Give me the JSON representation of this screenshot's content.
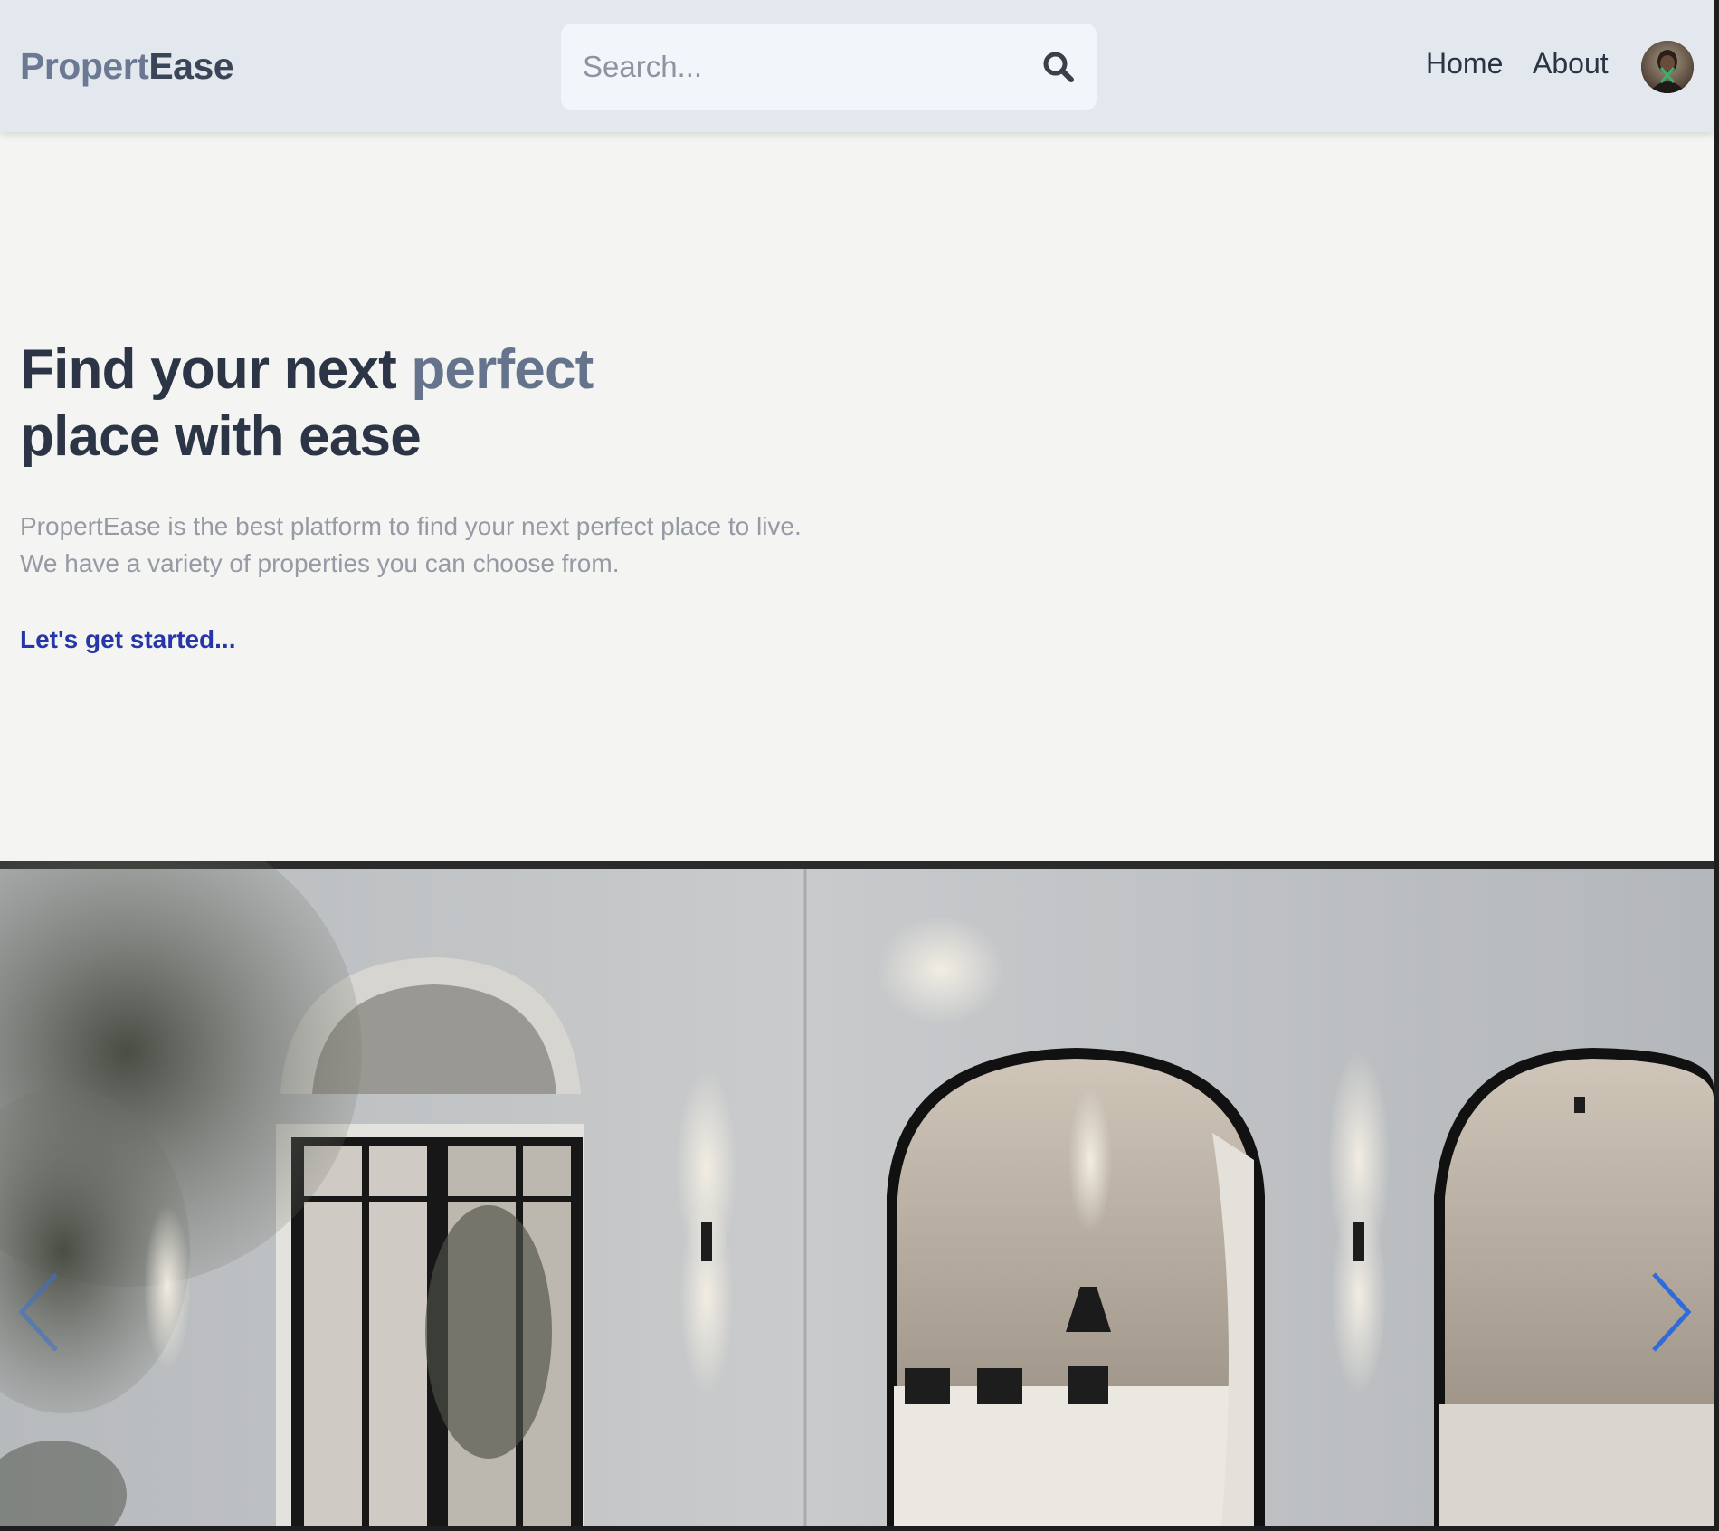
{
  "brand": {
    "part1": "Propert",
    "part2": "Ease"
  },
  "search": {
    "placeholder": "Search...",
    "value": "",
    "icon": "search-icon"
  },
  "nav": {
    "home_label": "Home",
    "about_label": "About",
    "avatar_icon": "user-avatar"
  },
  "hero": {
    "title_before": "Find your next ",
    "title_accent": "perfect",
    "title_after": "place with ease",
    "description_line1": "PropertEase is the best platform to find your next perfect place to live.",
    "description_line2": "We have a variety of properties you can choose from.",
    "cta_label": "Let's get started..."
  },
  "carousel": {
    "prev_icon": "chevron-left-icon",
    "next_icon": "chevron-right-icon"
  },
  "colors": {
    "header_bg": "#e3e7ee",
    "page_bg": "#f4f5f2",
    "heading": "#2c3545",
    "accent": "#65748c",
    "cta": "#2636a8",
    "arrow": "#2f6bdc"
  }
}
